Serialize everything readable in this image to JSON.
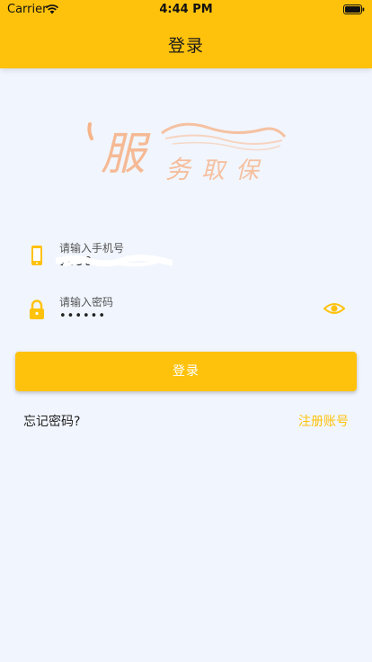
{
  "status_bar": {
    "carrier": "Carrier",
    "time": "4:44 PM"
  },
  "nav": {
    "title": "登录"
  },
  "logo": {
    "text": "服务取保"
  },
  "phone_field": {
    "label": "请输入手机号",
    "value": "1850",
    "icon": "phone-icon"
  },
  "password_field": {
    "label": "请输入密码",
    "value": "••••••",
    "icon": "lock-icon",
    "toggle_icon": "eye-icon"
  },
  "login_button": {
    "label": "登录"
  },
  "links": {
    "forgot": "忘记密码?",
    "register": "注册账号"
  },
  "colors": {
    "accent": "#fec20d",
    "background": "#f1f5fd"
  }
}
